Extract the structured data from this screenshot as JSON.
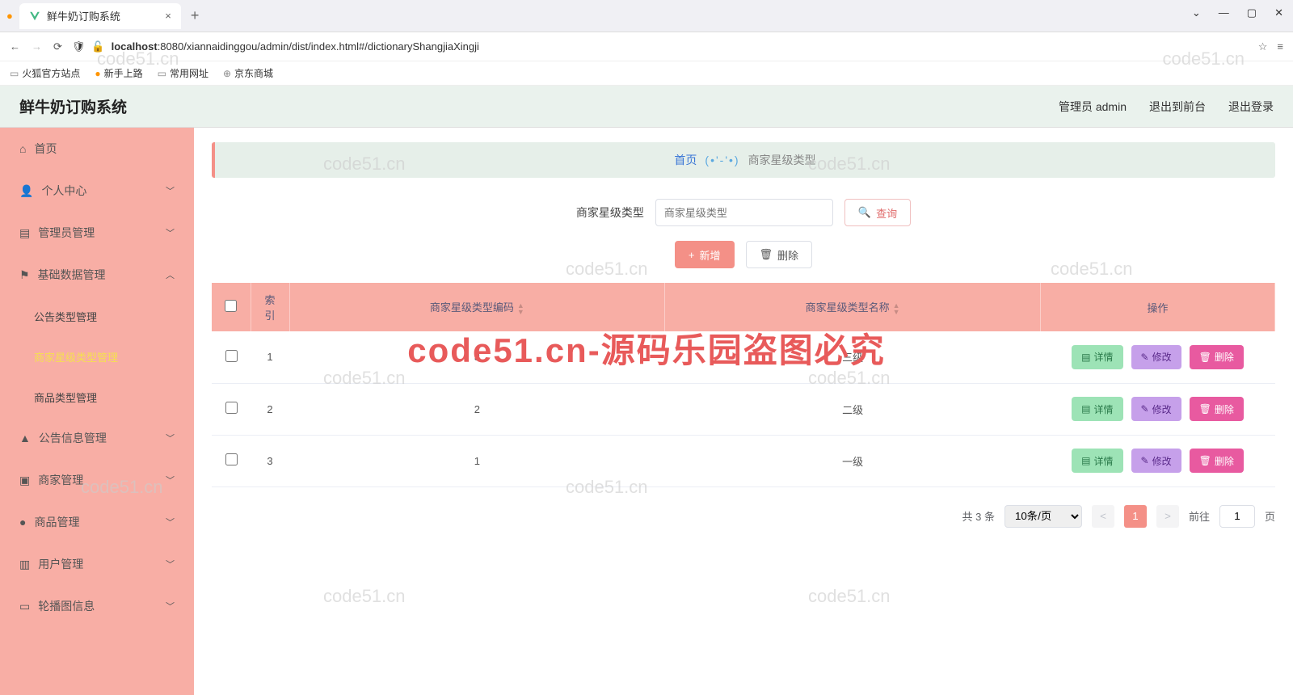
{
  "browser": {
    "tab_title": "鲜牛奶订购系统",
    "url_host": "localhost",
    "url_path": ":8080/xiannaidinggou/admin/dist/index.html#/dictionaryShangjiaXingji",
    "bookmarks": [
      "火狐官方站点",
      "新手上路",
      "常用网址",
      "京东商城"
    ]
  },
  "header": {
    "app_title": "鲜牛奶订购系统",
    "user_label": "管理员 admin",
    "back_front": "退出到前台",
    "logout": "退出登录"
  },
  "sidebar": {
    "items": [
      {
        "icon": "home",
        "label": "首页"
      },
      {
        "icon": "user",
        "label": "个人中心",
        "chev": true
      },
      {
        "icon": "admin",
        "label": "管理员管理",
        "chev": true
      },
      {
        "icon": "flag",
        "label": "基础数据管理",
        "chev": true,
        "open": true,
        "children": [
          {
            "label": "公告类型管理"
          },
          {
            "label": "商家星级类型管理",
            "active": true
          },
          {
            "label": "商品类型管理"
          }
        ]
      },
      {
        "icon": "bell",
        "label": "公告信息管理",
        "chev": true
      },
      {
        "icon": "shop",
        "label": "商家管理",
        "chev": true
      },
      {
        "icon": "goods",
        "label": "商品管理",
        "chev": true
      },
      {
        "icon": "chart",
        "label": "用户管理",
        "chev": true
      },
      {
        "icon": "screen",
        "label": "轮播图信息",
        "chev": true
      }
    ]
  },
  "breadcrumb": {
    "home": "首页",
    "face": "(•'-'•)",
    "current": "商家星级类型"
  },
  "search": {
    "label": "商家星级类型",
    "placeholder": "商家星级类型",
    "btn": "查询"
  },
  "actions": {
    "add": "新增",
    "batch_delete": "删除"
  },
  "table": {
    "headers": {
      "index": "索\n引",
      "code": "商家星级类型编码",
      "name": "商家星级类型名称",
      "ops": "操作"
    },
    "rows": [
      {
        "index": "1",
        "code": "3",
        "name": "三级"
      },
      {
        "index": "2",
        "code": "2",
        "name": "二级"
      },
      {
        "index": "3",
        "code": "1",
        "name": "一级"
      }
    ],
    "row_actions": {
      "detail": "详情",
      "edit": "修改",
      "delete": "删除"
    }
  },
  "pager": {
    "total_label": "共 3 条",
    "page_size": "10条/页",
    "goto_prefix": "前往",
    "goto_suffix": "页",
    "current": "1"
  },
  "watermark": "code51.cn",
  "big_watermark": "code51.cn-源码乐园盗图必究"
}
